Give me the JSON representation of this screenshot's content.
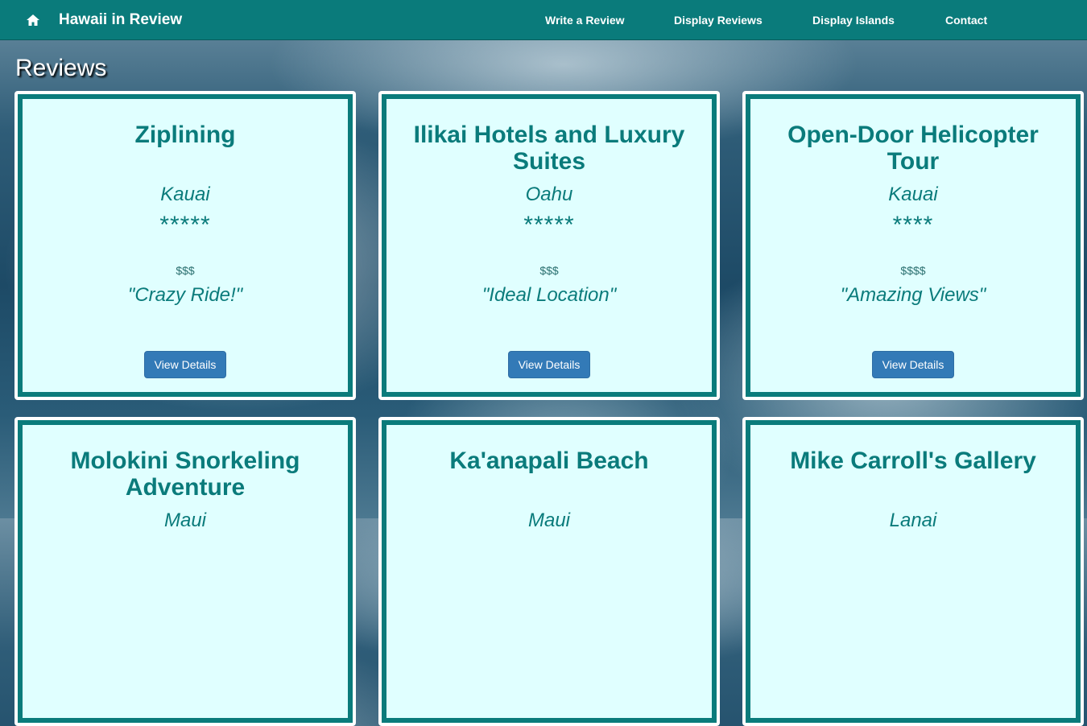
{
  "navbar": {
    "brand": "Hawaii in Review",
    "links": [
      "Write a Review",
      "Display Reviews",
      "Display Islands",
      "Contact"
    ]
  },
  "page": {
    "title": "Reviews"
  },
  "reviews": [
    {
      "title": "Ziplining",
      "island": "Kauai",
      "stars": "*****",
      "price": "$$$",
      "quote": "\"Crazy Ride!\"",
      "button": "View Details"
    },
    {
      "title": "Ilikai Hotels and Luxury Suites",
      "island": "Oahu",
      "stars": "*****",
      "price": "$$$",
      "quote": "\"Ideal Location\"",
      "button": "View Details"
    },
    {
      "title": "Open-Door Helicopter Tour",
      "island": "Kauai",
      "stars": "****",
      "price": "$$$$",
      "quote": "\"Amazing Views\"",
      "button": "View Details"
    },
    {
      "title": "Molokini Snorkeling Adventure",
      "island": "Maui"
    },
    {
      "title": "Ka'anapali Beach",
      "island": "Maui"
    },
    {
      "title": "Mike Carroll's Gallery",
      "island": "Lanai"
    }
  ],
  "colors": {
    "accent": "#0a7b7b",
    "card_bg": "#e0ffff",
    "button": "#337ab7"
  },
  "icons": {
    "home": "home-icon"
  }
}
